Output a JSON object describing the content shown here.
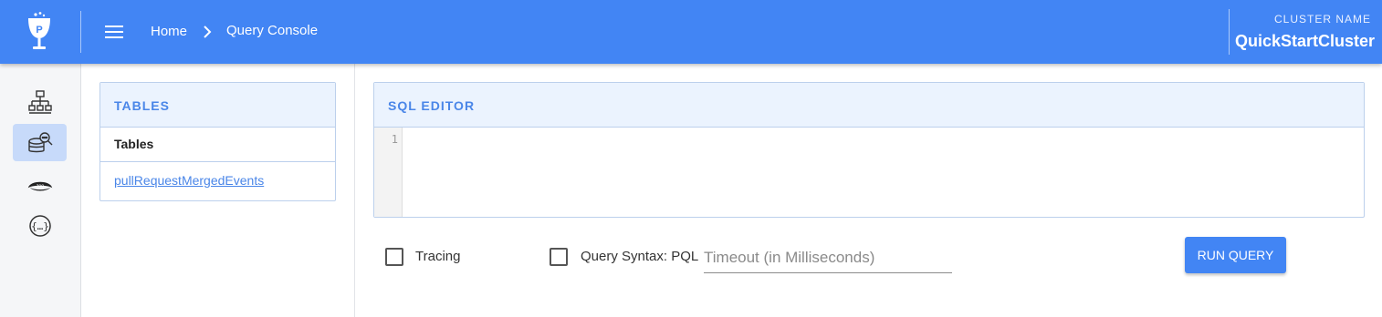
{
  "header": {
    "logo_icon": "pinot-logo-icon",
    "menu_icon": "hamburger-menu-icon",
    "breadcrumb": {
      "home": "Home",
      "separator_icon": "chevron-right-icon",
      "current": "Query Console"
    },
    "cluster_label": "CLUSTER NAME",
    "cluster_name": "QuickStartCluster"
  },
  "sidebar": {
    "items": [
      {
        "icon": "cluster-manager-icon",
        "active": false
      },
      {
        "icon": "query-console-icon",
        "active": true
      },
      {
        "icon": "zookeeper-icon",
        "active": false
      },
      {
        "icon": "swagger-api-icon",
        "active": false
      }
    ]
  },
  "tables_panel": {
    "title": "TABLES",
    "column_header": "Tables",
    "rows": [
      "pullRequestMergedEvents"
    ]
  },
  "sql_editor": {
    "title": "SQL EDITOR",
    "line_numbers": [
      "1"
    ],
    "content": ""
  },
  "options": {
    "tracing_label": "Tracing",
    "tracing_checked": false,
    "syntax_label": "Query Syntax: PQL",
    "syntax_checked": false,
    "timeout_placeholder": "Timeout (in Milliseconds)",
    "timeout_value": ""
  },
  "run_button": "RUN QUERY",
  "colors": {
    "primary": "#4285f4",
    "panel_header_bg": "#ebf3fe",
    "link": "#4a86e8"
  }
}
